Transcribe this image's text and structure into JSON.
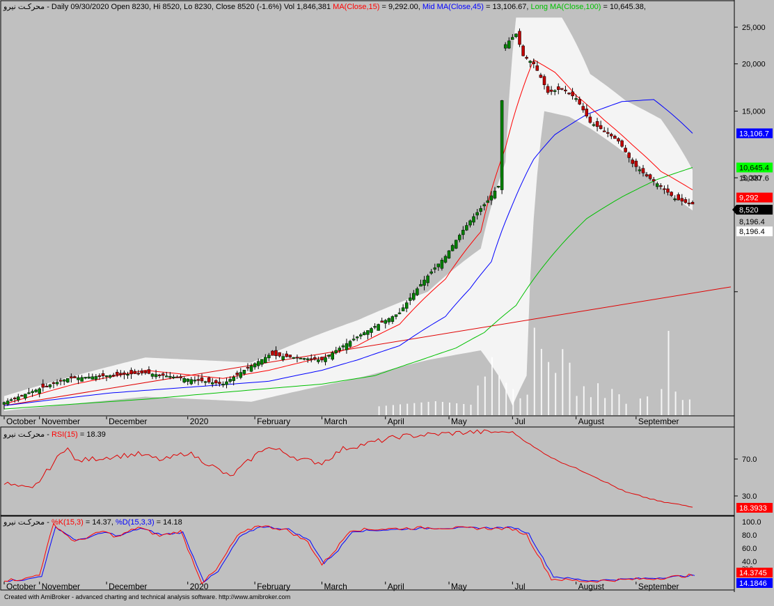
{
  "colors": {
    "background": "#c0c0c0",
    "panel_border": "#000000",
    "ma15": "#ff0000",
    "ma45": "#0000ff",
    "ma100": "#00c000",
    "trend": "#e00000",
    "band": "#f4f4f4",
    "candle_up": "#008000",
    "candle_down": "#c00000",
    "volume": "#ffffff",
    "rsi": "#e00000",
    "stoch_k": "#ff0000",
    "stoch_d": "#0000ff"
  },
  "price_panel": {
    "title_ticker": "محرکـت نیرو",
    "title_main": " - Daily 09/30/2020 Open 8230, Hi 8520, Lo 8230, Close 8520 (-1.6%) Vol 1,846,381 ",
    "title_ma15": "MA(Close,15)",
    "title_ma15_value": " = 9,292.00, ",
    "title_ma45": "Mid MA(Close,45)",
    "title_ma45_value": " = 13,106.67, ",
    "title_ma100": "Long MA(Close,100)",
    "title_ma100_value": " = 10,645.38,",
    "y_ticks": [
      "25,000",
      "20,000",
      "15,000",
      "5,000"
    ],
    "value_labels": [
      "13,106.7",
      "10,645.4",
      "10,387.6",
      "9,292",
      "8,520",
      "8,196.4",
      "8,196.4"
    ]
  },
  "x_axis": {
    "months": [
      "October",
      "November",
      "December",
      "2020",
      "February",
      "March",
      "April",
      "May",
      "Jul",
      "August",
      "September"
    ]
  },
  "rsi_panel": {
    "title_ticker": "محرکـت نیرو",
    "title_sep": " - ",
    "title_indicator": "RSI(15)",
    "title_value": " = 18.39",
    "y_ticks": [
      "70.0",
      "30.0"
    ],
    "value_label": "18.3933"
  },
  "stoch_panel": {
    "title_ticker": "محرکـت نیرو",
    "title_sep": " - ",
    "title_k": "%K(15,3)",
    "title_k_value": " = 14.37, ",
    "title_d": "%D(15,3,3)",
    "title_d_value": " = 14.18",
    "y_ticks": [
      "100.0",
      "80.0",
      "60.0",
      "40.0",
      "20.0"
    ],
    "k_label": "14.3745",
    "d_label": "14.1846"
  },
  "footer": {
    "text": "Created with AmiBroker - advanced charting and technical analysis software. http://www.amibroker.com"
  },
  "chart_data": [
    {
      "type": "candlestick",
      "y_scale": "log",
      "ylim": [
        2400,
        29000
      ],
      "yticks": [
        25000,
        20000,
        15000,
        10000,
        5000
      ],
      "annotation_values": [
        13106.7,
        10645.4,
        10387.6,
        9292,
        8520,
        8196.4
      ],
      "anchors": {
        "close": [
          [
            0,
            2550
          ],
          [
            18,
            2950
          ],
          [
            40,
            3050
          ],
          [
            62,
            2850
          ],
          [
            75,
            3400
          ],
          [
            90,
            3300
          ],
          [
            100,
            3800
          ],
          [
            112,
            4400
          ],
          [
            125,
            6200
          ],
          [
            132,
            7700
          ],
          [
            137,
            8700
          ],
          [
            140,
            9500
          ],
          [
            142,
            22500
          ],
          [
            145,
            24000
          ],
          [
            147,
            21000
          ],
          [
            150,
            20000
          ],
          [
            154,
            16800
          ],
          [
            158,
            17200
          ],
          [
            162,
            16200
          ],
          [
            166,
            14000
          ],
          [
            170,
            13300
          ],
          [
            174,
            12500
          ],
          [
            178,
            10900
          ],
          [
            182,
            10100
          ],
          [
            186,
            9500
          ],
          [
            190,
            8800
          ],
          [
            193,
            8600
          ],
          [
            195,
            8520
          ]
        ],
        "ma15": [
          [
            0,
            2520
          ],
          [
            20,
            2850
          ],
          [
            40,
            3100
          ],
          [
            62,
            2950
          ],
          [
            75,
            3100
          ],
          [
            90,
            3350
          ],
          [
            100,
            3600
          ],
          [
            112,
            4100
          ],
          [
            125,
            5400
          ],
          [
            135,
            7200
          ],
          [
            142,
            12000
          ],
          [
            150,
            20500
          ],
          [
            156,
            19000
          ],
          [
            162,
            16500
          ],
          [
            170,
            14200
          ],
          [
            178,
            12200
          ],
          [
            186,
            10400
          ],
          [
            195,
            9292
          ]
        ],
        "ma45": [
          [
            0,
            2500
          ],
          [
            30,
            2700
          ],
          [
            60,
            2830
          ],
          [
            75,
            2900
          ],
          [
            90,
            3100
          ],
          [
            100,
            3300
          ],
          [
            112,
            3600
          ],
          [
            125,
            4300
          ],
          [
            132,
            5100
          ],
          [
            138,
            6000
          ],
          [
            144,
            8500
          ],
          [
            150,
            11200
          ],
          [
            156,
            13000
          ],
          [
            165,
            14700
          ],
          [
            175,
            15900
          ],
          [
            184,
            16100
          ],
          [
            190,
            14500
          ],
          [
            195,
            13106.7
          ]
        ],
        "ma100": [
          [
            0,
            2450
          ],
          [
            40,
            2600
          ],
          [
            70,
            2750
          ],
          [
            90,
            2850
          ],
          [
            105,
            3000
          ],
          [
            118,
            3300
          ],
          [
            128,
            3550
          ],
          [
            136,
            3900
          ],
          [
            145,
            4600
          ],
          [
            155,
            6200
          ],
          [
            165,
            7800
          ],
          [
            175,
            8900
          ],
          [
            185,
            9900
          ],
          [
            195,
            10645.4
          ]
        ],
        "trend": [
          [
            0,
            2500
          ],
          [
            203,
            5150
          ]
        ],
        "band_upper": [
          [
            0,
            2650
          ],
          [
            40,
            3350
          ],
          [
            70,
            3250
          ],
          [
            100,
            4200
          ],
          [
            120,
            5000
          ],
          [
            135,
            6500
          ],
          [
            142,
            11000
          ],
          [
            145,
            26500
          ],
          [
            158,
            26500
          ],
          [
            166,
            18800
          ],
          [
            176,
            16000
          ],
          [
            186,
            14300
          ],
          [
            195,
            10500
          ]
        ],
        "band_lower": [
          [
            0,
            2420
          ],
          [
            40,
            2640
          ],
          [
            70,
            2560
          ],
          [
            100,
            2950
          ],
          [
            120,
            3300
          ],
          [
            135,
            3500
          ],
          [
            140,
            3000
          ],
          [
            144,
            2500
          ],
          [
            148,
            3000
          ],
          [
            153,
            15000
          ],
          [
            160,
            14500
          ],
          [
            166,
            13500
          ],
          [
            176,
            11600
          ],
          [
            186,
            9400
          ],
          [
            195,
            8196.4
          ]
        ]
      }
    },
    {
      "type": "bar",
      "series": "volume",
      "anchors": [
        [
          0,
          1
        ],
        [
          60,
          1.5
        ],
        [
          100,
          2
        ],
        [
          122,
          4
        ],
        [
          132,
          3
        ],
        [
          140,
          25
        ],
        [
          143,
          12
        ],
        [
          146,
          6
        ],
        [
          150,
          22
        ],
        [
          155,
          21
        ],
        [
          160,
          16
        ],
        [
          165,
          9
        ],
        [
          170,
          10
        ],
        [
          175,
          7
        ],
        [
          180,
          4
        ],
        [
          185,
          5
        ],
        [
          188,
          20
        ],
        [
          192,
          6
        ],
        [
          195,
          5
        ]
      ]
    },
    {
      "type": "line",
      "series": "RSI(15)",
      "ylim": [
        10,
        108
      ],
      "yticks": [
        70,
        30
      ],
      "current": 18.3933,
      "anchors": [
        [
          0,
          45
        ],
        [
          5,
          40
        ],
        [
          8,
          38
        ],
        [
          18,
          88
        ],
        [
          20,
          70
        ],
        [
          30,
          75
        ],
        [
          38,
          78
        ],
        [
          45,
          71
        ],
        [
          52,
          80
        ],
        [
          60,
          62
        ],
        [
          64,
          52
        ],
        [
          68,
          66
        ],
        [
          74,
          86
        ],
        [
          78,
          82
        ],
        [
          84,
          72
        ],
        [
          90,
          68
        ],
        [
          96,
          84
        ],
        [
          112,
          98
        ],
        [
          132,
          103
        ],
        [
          144,
          103
        ],
        [
          150,
          86
        ],
        [
          156,
          72
        ],
        [
          166,
          55
        ],
        [
          176,
          35
        ],
        [
          186,
          24
        ],
        [
          195,
          18.39
        ]
      ]
    },
    {
      "type": "line",
      "series": [
        "%K(15,3)",
        "%D(15,3,3)"
      ],
      "ylim": [
        0,
        112
      ],
      "yticks": [
        100,
        80,
        60,
        40,
        20
      ],
      "current": {
        "k": 14.3745,
        "d": 14.1846
      },
      "anchors_k": [
        [
          0,
          6
        ],
        [
          6,
          8
        ],
        [
          10,
          16
        ],
        [
          14,
          100
        ],
        [
          20,
          70
        ],
        [
          28,
          88
        ],
        [
          32,
          78
        ],
        [
          38,
          95
        ],
        [
          44,
          80
        ],
        [
          50,
          88
        ],
        [
          56,
          2
        ],
        [
          60,
          22
        ],
        [
          66,
          80
        ],
        [
          72,
          98
        ],
        [
          80,
          90
        ],
        [
          86,
          70
        ],
        [
          90,
          32
        ],
        [
          94,
          58
        ],
        [
          98,
          90
        ],
        [
          120,
          94
        ],
        [
          144,
          92
        ],
        [
          148,
          82
        ],
        [
          155,
          8
        ],
        [
          165,
          4
        ],
        [
          185,
          9
        ],
        [
          195,
          14.37
        ]
      ],
      "anchors_d": [
        [
          0,
          5
        ],
        [
          6,
          7
        ],
        [
          10,
          13
        ],
        [
          14,
          95
        ],
        [
          20,
          72
        ],
        [
          28,
          86
        ],
        [
          32,
          80
        ],
        [
          38,
          93
        ],
        [
          44,
          82
        ],
        [
          50,
          86
        ],
        [
          56,
          4
        ],
        [
          60,
          20
        ],
        [
          66,
          78
        ],
        [
          72,
          96
        ],
        [
          80,
          91
        ],
        [
          86,
          72
        ],
        [
          90,
          34
        ],
        [
          94,
          56
        ],
        [
          98,
          88
        ],
        [
          120,
          93
        ],
        [
          144,
          94
        ],
        [
          148,
          84
        ],
        [
          155,
          12
        ],
        [
          165,
          5
        ],
        [
          185,
          10
        ],
        [
          195,
          14.18
        ]
      ]
    }
  ]
}
